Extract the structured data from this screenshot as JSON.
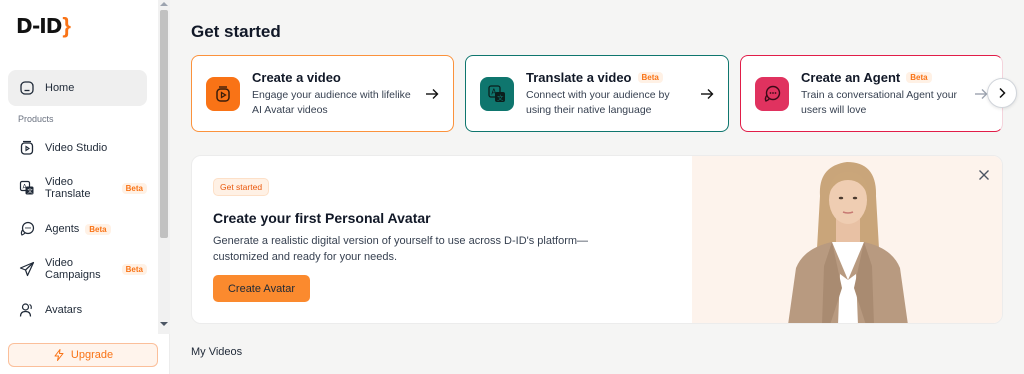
{
  "brand": {
    "logo_text": "D-ID",
    "accent": "#f97316"
  },
  "sidebar": {
    "home_label": "Home",
    "section_label": "Products",
    "items": [
      {
        "label": "Video Studio",
        "icon": "video-studio-icon",
        "beta": ""
      },
      {
        "label": "Video Translate",
        "icon": "translate-icon",
        "beta": "Beta"
      },
      {
        "label": "Agents",
        "icon": "agents-icon",
        "beta": "Beta"
      },
      {
        "label": "Video Campaigns",
        "icon": "campaign-icon",
        "beta": "Beta"
      },
      {
        "label": "Avatars",
        "icon": "avatars-icon",
        "beta": ""
      }
    ],
    "upgrade_label": "Upgrade"
  },
  "main": {
    "title": "Get started",
    "cards": [
      {
        "title": "Create a video",
        "beta": "",
        "desc": "Engage your audience with lifelike AI Avatar videos",
        "border": "#fb923c",
        "icon_bg": "#f97316"
      },
      {
        "title": "Translate a video",
        "beta": "Beta",
        "desc": "Connect with your audience by using their native language",
        "border": "#0f766e",
        "icon_bg": "#0f766e"
      },
      {
        "title": "Create an Agent",
        "beta": "Beta",
        "desc": "Train a conversational Agent your users will love",
        "border": "#e11d48",
        "icon_bg": "#e0325f"
      }
    ],
    "promo": {
      "badge": "Get started",
      "title": "Create your first Personal Avatar",
      "desc": "Generate a realistic digital version of yourself to use across D-ID's platform—customized and ready for your needs.",
      "button": "Create Avatar"
    },
    "my_videos": "My Videos"
  }
}
